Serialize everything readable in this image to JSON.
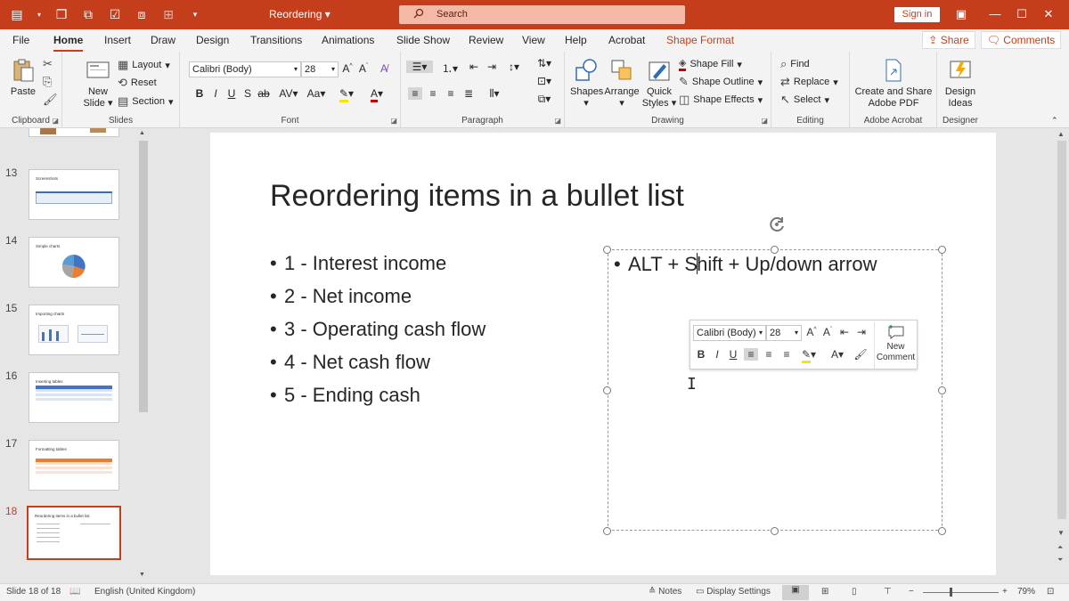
{
  "window": {
    "title": "Reordering",
    "search_placeholder": "Search",
    "signin_label": "Sign in"
  },
  "menu": {
    "tabs": [
      {
        "label": "File"
      },
      {
        "label": "Home"
      },
      {
        "label": "Insert"
      },
      {
        "label": "Draw"
      },
      {
        "label": "Design"
      },
      {
        "label": "Transitions"
      },
      {
        "label": "Animations"
      },
      {
        "label": "Slide Show"
      },
      {
        "label": "Review"
      },
      {
        "label": "View"
      },
      {
        "label": "Help"
      },
      {
        "label": "Acrobat"
      },
      {
        "label": "Shape Format"
      }
    ],
    "active_tab": "Home",
    "share_label": "Share",
    "comments_label": "Comments"
  },
  "ribbon": {
    "clipboard": {
      "label": "Clipboard",
      "paste": "Paste"
    },
    "slides": {
      "label": "Slides",
      "new_slide_line1": "New",
      "new_slide_line2": "Slide",
      "layout": "Layout",
      "reset": "Reset",
      "section": "Section"
    },
    "font": {
      "label": "Font",
      "font_name": "Calibri (Body)",
      "font_size": "28"
    },
    "paragraph": {
      "label": "Paragraph"
    },
    "drawing": {
      "label": "Drawing",
      "shapes": "Shapes",
      "arrange": "Arrange",
      "quick_styles_line1": "Quick",
      "quick_styles_line2": "Styles",
      "shape_fill": "Shape Fill",
      "shape_outline": "Shape Outline",
      "shape_effects": "Shape Effects"
    },
    "editing": {
      "label": "Editing",
      "find": "Find",
      "replace": "Replace",
      "select": "Select"
    },
    "adobe": {
      "label": "Adobe Acrobat",
      "line1": "Create and Share",
      "line2": "Adobe PDF"
    },
    "designer": {
      "label": "Designer",
      "line1": "Design",
      "line2": "Ideas"
    }
  },
  "thumbnails": [
    {
      "number": "13",
      "title": "Screenshots"
    },
    {
      "number": "14",
      "title": "Simple charts"
    },
    {
      "number": "15",
      "title": "Importing charts"
    },
    {
      "number": "16",
      "title": "Inserting tables"
    },
    {
      "number": "17",
      "title": "Formatting tables"
    },
    {
      "number": "18",
      "title": "Reordering items in a bullet list"
    }
  ],
  "slide": {
    "title": "Reordering items in a bullet list",
    "bullets": [
      "1 - Interest income",
      "2 - Net income",
      "3 - Operating cash flow",
      "4 - Net cash flow",
      "5 - Ending cash"
    ],
    "textbox_before_caret": "ALT + S",
    "textbox_after_caret": "hift + Up/down arrow"
  },
  "mini_toolbar": {
    "font_name": "Calibri (Body)",
    "font_size": "28",
    "new_comment_line1": "New",
    "new_comment_line2": "Comment"
  },
  "status": {
    "slide_count": "Slide 18 of 18",
    "language": "English (United Kingdom)",
    "notes": "Notes",
    "display_settings": "Display Settings",
    "zoom": "79%"
  },
  "colors": {
    "accent": "#c43e1c",
    "ribbon_bg": "#f3f3f3"
  }
}
